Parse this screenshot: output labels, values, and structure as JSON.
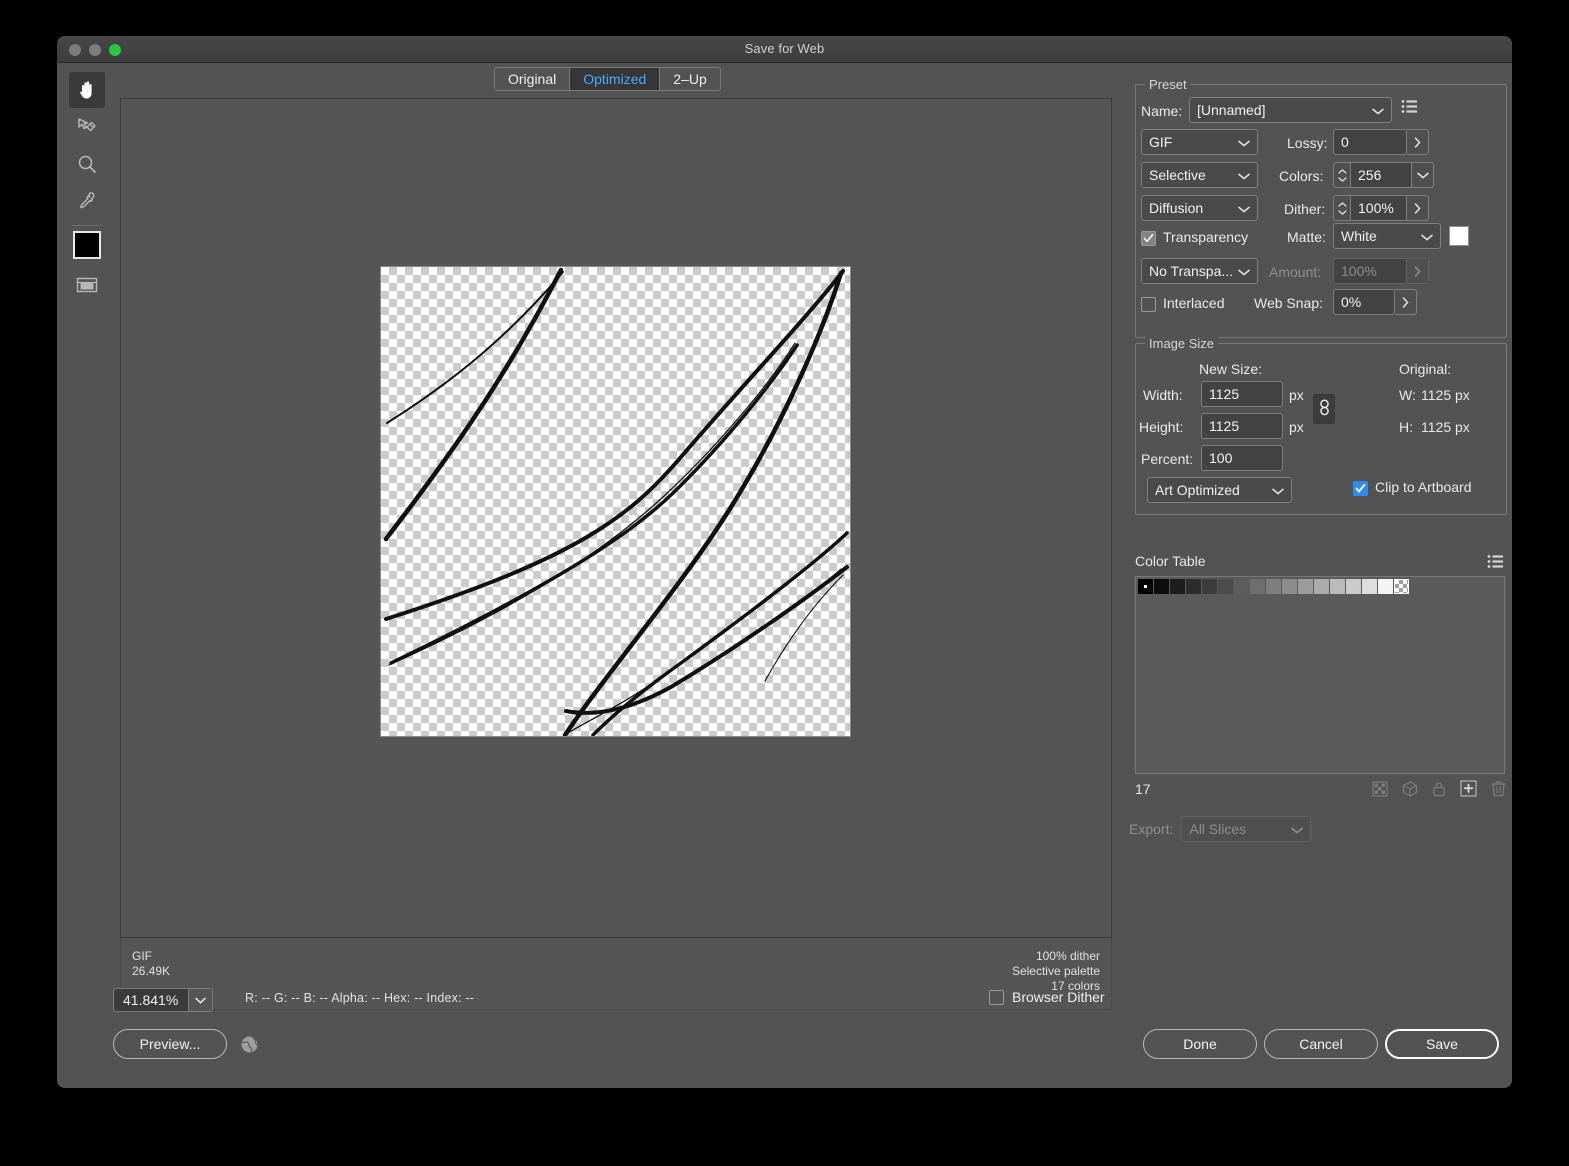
{
  "window": {
    "title": "Save for Web",
    "traffic_lights": [
      "close",
      "minimize",
      "maximize"
    ]
  },
  "tabs": [
    {
      "label": "Original",
      "active": false
    },
    {
      "label": "Optimized",
      "active": true
    },
    {
      "label": "2–Up",
      "active": false
    }
  ],
  "toolbar": {
    "tools": [
      {
        "name": "hand-tool",
        "active": true
      },
      {
        "name": "slice-select-tool",
        "active": false
      },
      {
        "name": "zoom-tool",
        "active": false
      },
      {
        "name": "eyedropper-tool",
        "active": false
      }
    ],
    "eyedropper_color": "#000000",
    "toggle_slices_name": "toggle-slices-visibility"
  },
  "preview": {
    "artwork_description": "black diagonal brush strokes on transparency checkerboard",
    "checker_light": "#ffffff",
    "checker_dark": "#cccccc",
    "stroke_color": "#111111"
  },
  "info_strip": {
    "left_lines": [
      "GIF",
      "26.49K"
    ],
    "right_lines": [
      "100% dither",
      "Selective palette",
      "17 colors"
    ]
  },
  "status_bar": {
    "zoom_value": "41.841%",
    "color_readout": "R: --  G: --  B: --  Alpha: --  Hex: --  Index: --",
    "browser_dither_label": "Browser Dither",
    "browser_dither_checked": false
  },
  "bottom_buttons": {
    "preview": "Preview...",
    "globe_icon": "globe-icon",
    "done": "Done",
    "cancel": "Cancel",
    "save": "Save"
  },
  "preset": {
    "group_title": "Preset",
    "name_label": "Name:",
    "name_value": "[Unnamed]",
    "menu_icon": "preset-menu-icon",
    "format_value": "GIF",
    "lossy_label": "Lossy:",
    "lossy_value": "0",
    "palette_value": "Selective",
    "colors_label": "Colors:",
    "colors_value": "256",
    "dither_algo_value": "Diffusion",
    "dither_label": "Dither:",
    "dither_value": "100%",
    "transparency_label": "Transparency",
    "transparency_checked": true,
    "matte_label": "Matte:",
    "matte_value": "White",
    "matte_color": "#ffffff",
    "transparency_dither_value": "No Transpa...",
    "amount_label": "Amount:",
    "amount_value": "100%",
    "amount_disabled": true,
    "interlaced_label": "Interlaced",
    "interlaced_checked": false,
    "web_snap_label": "Web Snap:",
    "web_snap_value": "0%"
  },
  "image_size": {
    "group_title": "Image Size",
    "new_size_label": "New Size:",
    "original_label": "Original:",
    "width_label": "Width:",
    "width_value": "1125",
    "width_unit": "px",
    "height_label": "Height:",
    "height_value": "1125",
    "height_unit": "px",
    "percent_label": "Percent:",
    "percent_value": "100",
    "original_width_label": "W:",
    "original_width_value": "1125 px",
    "original_height_label": "H:",
    "original_height_value": "1125 px",
    "quality_value": "Art Optimized",
    "clip_label": "Clip to Artboard",
    "clip_checked": true,
    "link_icon": "link-chain-icon"
  },
  "color_table": {
    "title": "Color Table",
    "menu_icon": "color-table-menu-icon",
    "count": "17",
    "swatches": [
      {
        "color": "#000000",
        "selected": true
      },
      {
        "color": "#0d0d0d",
        "selected": false
      },
      {
        "color": "#1d1d1d",
        "selected": false
      },
      {
        "color": "#2c2c2c",
        "selected": false
      },
      {
        "color": "#3b3b3b",
        "selected": false
      },
      {
        "color": "#4c4c4c",
        "selected": false
      },
      {
        "color": "#5d5d5d",
        "selected": false
      },
      {
        "color": "#6e6e6e",
        "selected": false
      },
      {
        "color": "#7e7e7e",
        "selected": false
      },
      {
        "color": "#8d8d8d",
        "selected": false
      },
      {
        "color": "#9c9c9c",
        "selected": false
      },
      {
        "color": "#ababab",
        "selected": false
      },
      {
        "color": "#bbbbbb",
        "selected": false
      },
      {
        "color": "#cbcbcb",
        "selected": false
      },
      {
        "color": "#dedede",
        "selected": false
      },
      {
        "color": "#f4f4f4",
        "selected": false
      },
      {
        "color": "transparent",
        "selected": false
      }
    ],
    "tool_icons": [
      "transparency-icon",
      "web-safe-cube-icon",
      "lock-icon",
      "new-color-icon",
      "delete-color-icon"
    ],
    "export_label": "Export:",
    "export_value": "All Slices"
  }
}
